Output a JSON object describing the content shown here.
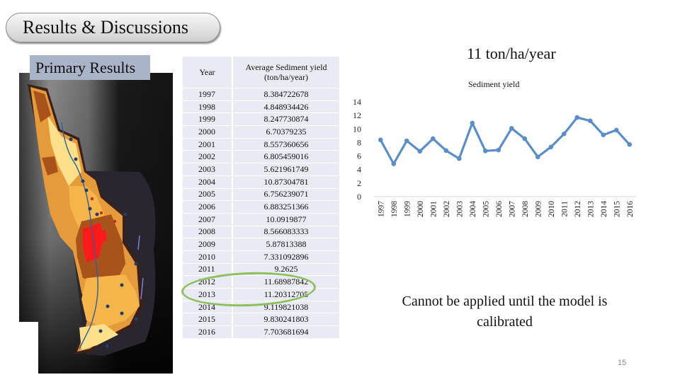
{
  "slide": {
    "title": "Results & Discussions",
    "subtitle": "Primary Results",
    "highlight_note": "11 ton/ha/year",
    "note": "Cannot be applied until the model is calibrated",
    "page_number": "15"
  },
  "table": {
    "headers": [
      "Year",
      "Average Sediment yield (ton/ha/year)"
    ],
    "rows": [
      [
        "1997",
        "8.384722678"
      ],
      [
        "1998",
        "4.848934426"
      ],
      [
        "1999",
        "8.247730874"
      ],
      [
        "2000",
        "6.70379235"
      ],
      [
        "2001",
        "8.557360656"
      ],
      [
        "2002",
        "6.805459016"
      ],
      [
        "2003",
        "5.621961749"
      ],
      [
        "2004",
        "10.87304781"
      ],
      [
        "2005",
        "6.756239071"
      ],
      [
        "2006",
        "6.883251366"
      ],
      [
        "2007",
        "10.0919877"
      ],
      [
        "2008",
        "8.566083333"
      ],
      [
        "2009",
        "5.87813388"
      ],
      [
        "2010",
        "7.331092896"
      ],
      [
        "2011",
        "9.2625"
      ],
      [
        "2012",
        "11.68987842"
      ],
      [
        "2013",
        "11.20312705"
      ],
      [
        "2014",
        "9.119821038"
      ],
      [
        "2015",
        "9.830241803"
      ],
      [
        "2016",
        "7.703681694"
      ]
    ],
    "highlighted_years": [
      "2012",
      "2013"
    ],
    "highlight_color": "#8fbf5a"
  },
  "map": {
    "description": "Watershed sediment yield map over grayscale terrain",
    "legend_colors": [
      "#ffe08a",
      "#f6b54a",
      "#d98a2b",
      "#a9531c",
      "#ff1a1a"
    ]
  },
  "chart_data": {
    "type": "line",
    "title": "Sediment yield",
    "xlabel": "",
    "ylabel": "",
    "categories": [
      "1997",
      "1998",
      "1999",
      "2000",
      "2001",
      "2002",
      "2003",
      "2004",
      "2005",
      "2006",
      "2007",
      "2008",
      "2009",
      "2010",
      "2011",
      "2012",
      "2013",
      "2014",
      "2015",
      "2016"
    ],
    "series": [
      {
        "name": "Sediment yield",
        "color": "#5b8ec7",
        "values": [
          8.384722678,
          4.848934426,
          8.247730874,
          6.70379235,
          8.557360656,
          6.805459016,
          5.621961749,
          10.87304781,
          6.756239071,
          6.883251366,
          10.0919877,
          8.566083333,
          5.87813388,
          7.331092896,
          9.2625,
          11.68987842,
          11.20312705,
          9.119821038,
          9.830241803,
          7.703681694
        ]
      }
    ],
    "ylim": [
      0,
      14
    ],
    "yticks": [
      0,
      2,
      4,
      6,
      8,
      10,
      12,
      14
    ],
    "grid": false,
    "legend": "none"
  }
}
